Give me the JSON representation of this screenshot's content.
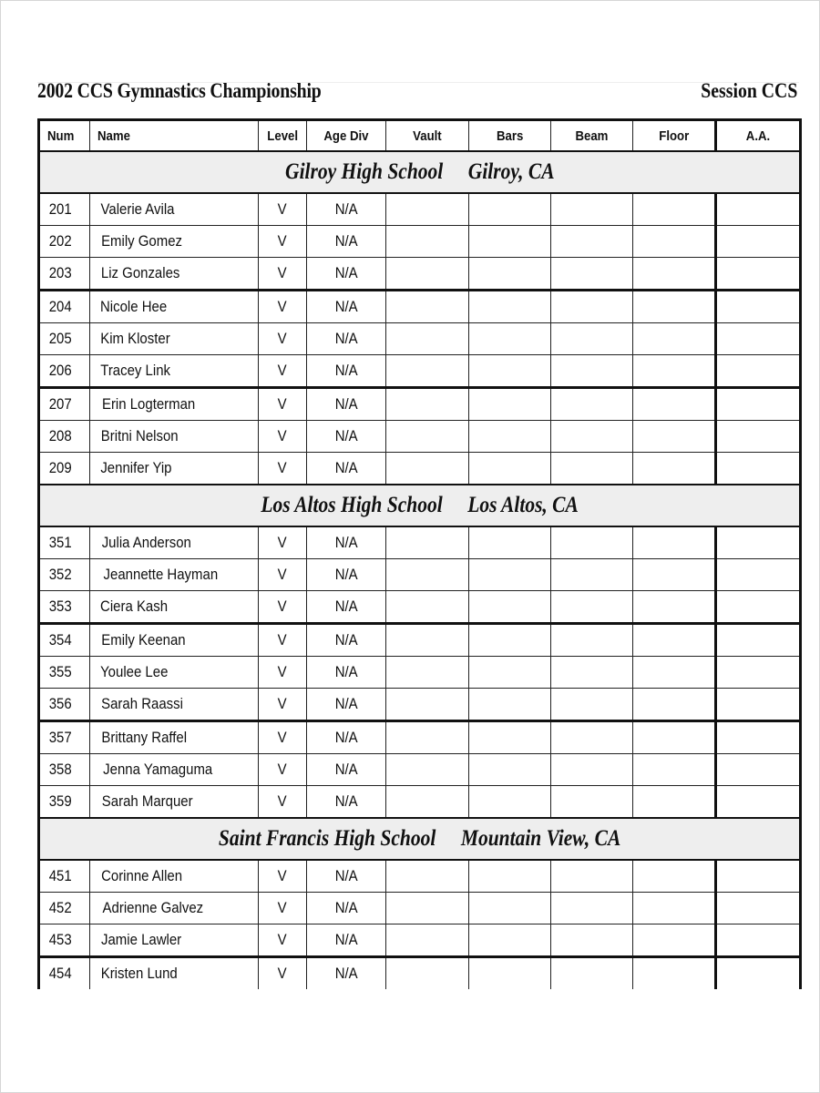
{
  "document": {
    "title": "2002 CCS Gymnastics Championship",
    "session": "Session CCS"
  },
  "table": {
    "columns": [
      "Num",
      "Name",
      "Level",
      "Age Div",
      "Vault",
      "Bars",
      "Beam",
      "Floor",
      "A.A."
    ],
    "sections": [
      {
        "school": "Gilroy High School",
        "city": "Gilroy, CA",
        "rows": [
          {
            "num": "201",
            "name": "Valerie Avila",
            "level": "V",
            "age_div": "N/A",
            "vault": "",
            "bars": "",
            "beam": "",
            "floor": "",
            "aa": ""
          },
          {
            "num": "202",
            "name": "Emily Gomez",
            "level": "V",
            "age_div": "N/A",
            "vault": "",
            "bars": "",
            "beam": "",
            "floor": "",
            "aa": ""
          },
          {
            "num": "203",
            "name": "Liz Gonzales",
            "level": "V",
            "age_div": "N/A",
            "vault": "",
            "bars": "",
            "beam": "",
            "floor": "",
            "aa": ""
          },
          {
            "num": "204",
            "name": "Nicole Hee",
            "level": "V",
            "age_div": "N/A",
            "vault": "",
            "bars": "",
            "beam": "",
            "floor": "",
            "aa": ""
          },
          {
            "num": "205",
            "name": "Kim Kloster",
            "level": "V",
            "age_div": "N/A",
            "vault": "",
            "bars": "",
            "beam": "",
            "floor": "",
            "aa": ""
          },
          {
            "num": "206",
            "name": "Tracey Link",
            "level": "V",
            "age_div": "N/A",
            "vault": "",
            "bars": "",
            "beam": "",
            "floor": "",
            "aa": ""
          },
          {
            "num": "207",
            "name": "Erin Logterman",
            "level": "V",
            "age_div": "N/A",
            "vault": "",
            "bars": "",
            "beam": "",
            "floor": "",
            "aa": ""
          },
          {
            "num": "208",
            "name": "Britni Nelson",
            "level": "V",
            "age_div": "N/A",
            "vault": "",
            "bars": "",
            "beam": "",
            "floor": "",
            "aa": ""
          },
          {
            "num": "209",
            "name": "Jennifer Yip",
            "level": "V",
            "age_div": "N/A",
            "vault": "",
            "bars": "",
            "beam": "",
            "floor": "",
            "aa": ""
          }
        ]
      },
      {
        "school": "Los Altos High School",
        "city": "Los Altos, CA",
        "rows": [
          {
            "num": "351",
            "name": "Julia Anderson",
            "level": "V",
            "age_div": "N/A",
            "vault": "",
            "bars": "",
            "beam": "",
            "floor": "",
            "aa": ""
          },
          {
            "num": "352",
            "name": "Jeannette Hayman",
            "level": "V",
            "age_div": "N/A",
            "vault": "",
            "bars": "",
            "beam": "",
            "floor": "",
            "aa": ""
          },
          {
            "num": "353",
            "name": "Ciera Kash",
            "level": "V",
            "age_div": "N/A",
            "vault": "",
            "bars": "",
            "beam": "",
            "floor": "",
            "aa": ""
          },
          {
            "num": "354",
            "name": "Emily Keenan",
            "level": "V",
            "age_div": "N/A",
            "vault": "",
            "bars": "",
            "beam": "",
            "floor": "",
            "aa": ""
          },
          {
            "num": "355",
            "name": "Youlee Lee",
            "level": "V",
            "age_div": "N/A",
            "vault": "",
            "bars": "",
            "beam": "",
            "floor": "",
            "aa": ""
          },
          {
            "num": "356",
            "name": "Sarah Raassi",
            "level": "V",
            "age_div": "N/A",
            "vault": "",
            "bars": "",
            "beam": "",
            "floor": "",
            "aa": ""
          },
          {
            "num": "357",
            "name": "Brittany Raffel",
            "level": "V",
            "age_div": "N/A",
            "vault": "",
            "bars": "",
            "beam": "",
            "floor": "",
            "aa": ""
          },
          {
            "num": "358",
            "name": "Jenna Yamaguma",
            "level": "V",
            "age_div": "N/A",
            "vault": "",
            "bars": "",
            "beam": "",
            "floor": "",
            "aa": ""
          },
          {
            "num": "359",
            "name": "Sarah Marquer",
            "level": "V",
            "age_div": "N/A",
            "vault": "",
            "bars": "",
            "beam": "",
            "floor": "",
            "aa": ""
          }
        ]
      },
      {
        "school": "Saint Francis High School",
        "city": "Mountain View, CA",
        "rows": [
          {
            "num": "451",
            "name": "Corinne Allen",
            "level": "V",
            "age_div": "N/A",
            "vault": "",
            "bars": "",
            "beam": "",
            "floor": "",
            "aa": ""
          },
          {
            "num": "452",
            "name": "Adrienne Galvez",
            "level": "V",
            "age_div": "N/A",
            "vault": "",
            "bars": "",
            "beam": "",
            "floor": "",
            "aa": ""
          },
          {
            "num": "453",
            "name": "Jamie Lawler",
            "level": "V",
            "age_div": "N/A",
            "vault": "",
            "bars": "",
            "beam": "",
            "floor": "",
            "aa": ""
          },
          {
            "num": "454",
            "name": "Kristen Lund",
            "level": "V",
            "age_div": "N/A",
            "vault": "",
            "bars": "",
            "beam": "",
            "floor": "",
            "aa": ""
          }
        ]
      }
    ]
  }
}
